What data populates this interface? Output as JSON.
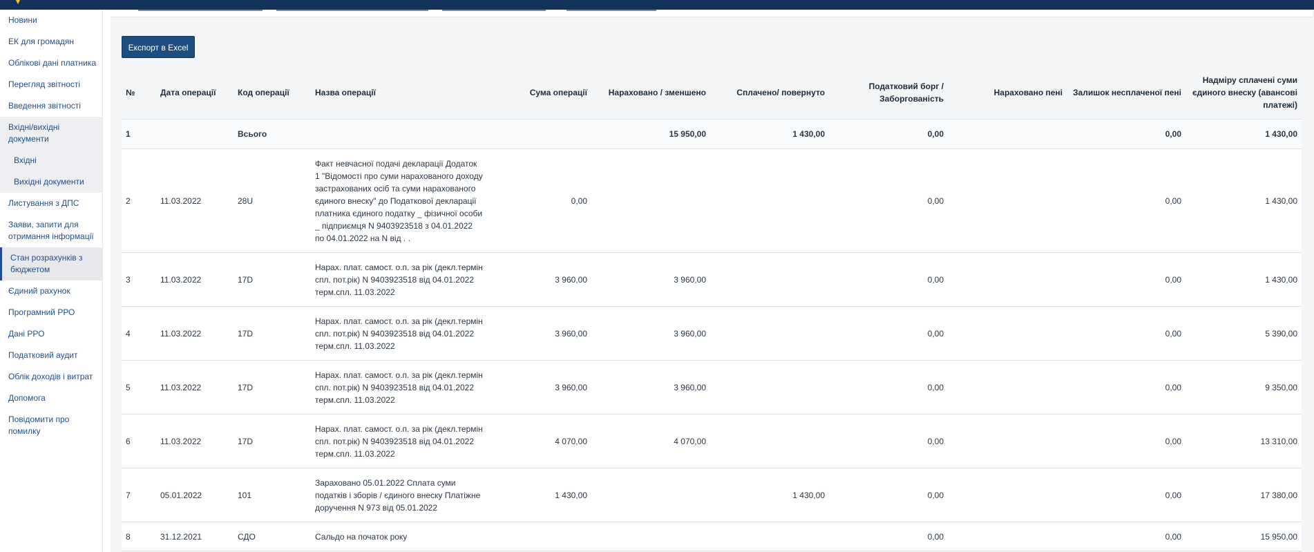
{
  "sidebar": {
    "items": [
      {
        "label": "Новини"
      },
      {
        "label": "ЕК для громадян"
      },
      {
        "label": "Облікові дані платника"
      },
      {
        "label": "Перегляд звітності"
      },
      {
        "label": "Введення звітності"
      },
      {
        "label": "Вхідні/вихідні документи"
      },
      {
        "label": "Вхідні"
      },
      {
        "label": "Вихідні документи"
      },
      {
        "label": "Листування з ДПС"
      },
      {
        "label": "Заяви, запити для отримання інформації"
      },
      {
        "label": "Стан розрахунків з бюджетом"
      },
      {
        "label": "Єдиний рахунок"
      },
      {
        "label": "Програмний РРО"
      },
      {
        "label": "Дані РРО"
      },
      {
        "label": "Податковий аудит"
      },
      {
        "label": "Облік доходів і витрат"
      },
      {
        "label": "Допомога"
      },
      {
        "label": "Повідомити про помилку"
      }
    ]
  },
  "toolbar": {
    "export_label": "Експорт в Excel"
  },
  "table": {
    "headers": {
      "num": "№",
      "date": "Дата операції",
      "code": "Код операції",
      "name": "Назва операції",
      "sum": "Сума операції",
      "accrued": "Нараховано / зменшено",
      "paid": "Сплачено/ повернуто",
      "debt": "Податковий борг / Заборгованість",
      "penalty": "Нараховано пені",
      "penalty_left": "Залишок несплаченої пені",
      "overpaid": "Надміру сплачені суми єдиного внеску (авансові платежі)"
    },
    "total": {
      "num": "1",
      "code": "Всього",
      "accrued": "15 950,00",
      "paid": "1 430,00",
      "debt": "0,00",
      "penalty_left": "0,00",
      "overpaid": "1 430,00"
    },
    "rows": [
      {
        "num": "2",
        "date": "11.03.2022",
        "code": "28U",
        "name": "Факт невчасної подачі декларації Додаток 1 \"Відомості про суми нарахованого доходу застрахованих осіб та суми нарахованого єдиного внеску\" до Податкової декларації платника єдиного податку _ фізичної особи _ підприємця N 9403923518 з 04.01.2022 по 04.01.2022 на N від . .",
        "sum": "0,00",
        "accrued": "",
        "paid": "",
        "debt": "0,00",
        "penalty": "",
        "penalty_left": "0,00",
        "overpaid": "1 430,00"
      },
      {
        "num": "3",
        "date": "11.03.2022",
        "code": "17D",
        "name": "Нарах. плат. самост. о.п. за рік (декл.термін спл. пот.рік) N 9403923518 від 04.01.2022 терм.спл. 11.03.2022",
        "sum": "3 960,00",
        "accrued": "3 960,00",
        "paid": "",
        "debt": "0,00",
        "penalty": "",
        "penalty_left": "0,00",
        "overpaid": "1 430,00"
      },
      {
        "num": "4",
        "date": "11.03.2022",
        "code": "17D",
        "name": "Нарах. плат. самост. о.п. за рік (декл.термін спл. пот.рік) N 9403923518 від 04.01.2022 терм.спл. 11.03.2022",
        "sum": "3 960,00",
        "accrued": "3 960,00",
        "paid": "",
        "debt": "0,00",
        "penalty": "",
        "penalty_left": "0,00",
        "overpaid": "5 390,00"
      },
      {
        "num": "5",
        "date": "11.03.2022",
        "code": "17D",
        "name": "Нарах. плат. самост. о.п. за рік (декл.термін спл. пот.рік) N 9403923518 від 04.01.2022 терм.спл. 11.03.2022",
        "sum": "3 960,00",
        "accrued": "3 960,00",
        "paid": "",
        "debt": "0,00",
        "penalty": "",
        "penalty_left": "0,00",
        "overpaid": "9 350,00"
      },
      {
        "num": "6",
        "date": "11.03.2022",
        "code": "17D",
        "name": "Нарах. плат. самост. о.п. за рік (декл.термін спл. пот.рік) N 9403923518 від 04.01.2022 терм.спл. 11.03.2022",
        "sum": "4 070,00",
        "accrued": "4 070,00",
        "paid": "",
        "debt": "0,00",
        "penalty": "",
        "penalty_left": "0,00",
        "overpaid": "13 310,00"
      },
      {
        "num": "7",
        "date": "05.01.2022",
        "code": "101",
        "name": "Зараховано 05.01.2022 Сплата суми податків і зборів / єдиного внеску Платіжне доручення N 973 від 05.01.2022",
        "sum": "1 430,00",
        "accrued": "",
        "paid": "1 430,00",
        "debt": "0,00",
        "penalty": "",
        "penalty_left": "0,00",
        "overpaid": "17 380,00"
      },
      {
        "num": "8",
        "date": "31.12.2021",
        "code": "СДО",
        "name": "Сальдо на початок року",
        "sum": "",
        "accrued": "",
        "paid": "",
        "debt": "0,00",
        "penalty": "",
        "penalty_left": "0,00",
        "overpaid": "15 950,00"
      }
    ]
  }
}
